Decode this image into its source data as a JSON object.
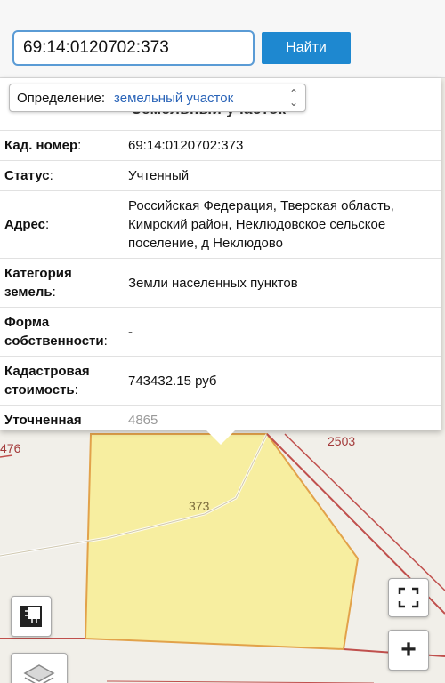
{
  "search": {
    "value": "69:14:0120702:373",
    "button_label": "Найти"
  },
  "panel": {
    "definition_label": "Определение:",
    "definition_value": "земельный участок",
    "ghost_title": "Земельный участок",
    "rows": [
      {
        "key": "Кад. номер",
        "value": "69:14:0120702:373"
      },
      {
        "key": "Статус",
        "value": "Учтенный"
      },
      {
        "key": "Адрес",
        "value": "Российская Федерация, Тверская область, Кимрский район, Неклюдовское сельское поселение, д Неклюдово"
      },
      {
        "key_line1": "Категория",
        "key_line2": "земель",
        "value": "Земли населенных пунктов"
      },
      {
        "key_line1": "Форма",
        "key_line2": "собственности",
        "value": "-"
      },
      {
        "key_line1": "Кадастровая",
        "key_line2": "стоимость",
        "value": "743432.15 руб"
      },
      {
        "key": "Уточненная",
        "value": "4865"
      }
    ],
    "colon": ":"
  },
  "map": {
    "labels": {
      "left_number": "476",
      "right_number": "2503",
      "parcel_number": "373"
    },
    "colors": {
      "parcel_fill": "#f7eea0",
      "parcel_border": "#e2a24a",
      "boundary": "#c0504d"
    }
  },
  "controls": {
    "zoom_in_label": "+"
  }
}
